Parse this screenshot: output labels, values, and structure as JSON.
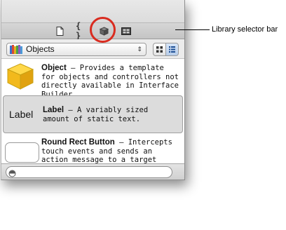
{
  "library_selector": {
    "tabs": [
      {
        "icon": "file-template-icon"
      },
      {
        "label": "{ }",
        "icon": "code-snippet-icon"
      },
      {
        "icon": "object-cube-icon",
        "selected": true
      },
      {
        "icon": "media-icon"
      }
    ]
  },
  "filter": {
    "popup_value": "Objects",
    "view_modes": [
      "icon-view",
      "list-view"
    ],
    "selected_view": "list-view"
  },
  "library_items": [
    {
      "name": "Object",
      "description": " – Provides a template for objects and controllers not directly available in Interface Builder."
    },
    {
      "icon_text": "Label",
      "name": "Label",
      "description": " – A variably sized amount of static text."
    },
    {
      "name": "Round Rect Button",
      "description": " – Intercepts touch events and sends an action message to a target object when it's tapped."
    }
  ],
  "search": {
    "placeholder": ""
  },
  "callout": {
    "text": "Library selector bar"
  },
  "colors": {
    "highlight_circle": "#d92b1f",
    "selection": "#dcdcdc"
  }
}
